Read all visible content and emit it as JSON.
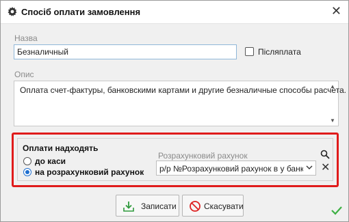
{
  "window": {
    "title": "Спосіб оплати замовлення",
    "close_glyph": "✕"
  },
  "name_field": {
    "label": "Назва",
    "value": "Безналичный"
  },
  "postpay": {
    "label": "Післяплата",
    "checked": false
  },
  "description": {
    "label": "Опис",
    "value": "Оплата счет-фактуры, банковскими картами и другие безналичные способы расчета."
  },
  "payment_group": {
    "title": "Оплати надходять",
    "options": [
      {
        "label": "до каси",
        "selected": false
      },
      {
        "label": "на розрахунковий рахунок",
        "selected": true
      }
    ],
    "account_label": "Розрахунковий рахунок",
    "account_value": "р/р №Розрахунковий рахунок в у банку"
  },
  "buttons": {
    "save": "Записати",
    "cancel": "Скасувати"
  },
  "colors": {
    "highlight_frame": "#e01b1b",
    "accent": "#1e6fd0",
    "ok_check": "#3cb043"
  }
}
